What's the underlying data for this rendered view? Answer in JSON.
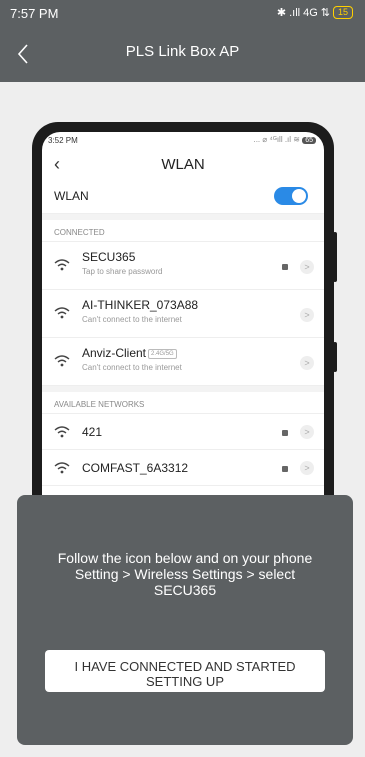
{
  "status_bar": {
    "time": "7:57 PM",
    "bluetooth": "✱",
    "signal": ".ıll",
    "network": "4G",
    "arrows": "⇅",
    "battery": "15"
  },
  "header": {
    "title": "PLS Link Box AP"
  },
  "illustration": {
    "status_time": "3:52 PM",
    "status_right": "... ⌀ ⁴ᴳıll .ıl ≋",
    "battery": "65",
    "screen_title": "WLAN",
    "back_glyph": "‹",
    "wlan_label": "WLAN",
    "wlan_toggle_on": true,
    "connected_label": "CONNECTED",
    "connected": [
      {
        "name": "SECU365",
        "sub": "Tap to share password",
        "locked": true
      },
      {
        "name": "AI-THINKER_073A88",
        "sub": "Can't connect to the internet",
        "locked": false
      },
      {
        "name": "Anviz-Client",
        "tag": "2.4G/5G",
        "sub": "Can't connect to the internet",
        "locked": false
      }
    ],
    "available_label": "AVAILABLE NETWORKS",
    "available": [
      {
        "name": "421",
        "locked": true
      },
      {
        "name": "COMFAST_6A3312",
        "locked": true
      }
    ],
    "arrow_glyph": ">"
  },
  "dialog": {
    "message": "Follow the icon below and on your phone Setting > Wireless Settings > select SECU365",
    "button_label": "I HAVE CONNECTED AND STARTED SETTING UP"
  },
  "colors": {
    "bar": "#5c6062",
    "background": "#eeeeee",
    "toggle": "#2a8ae6",
    "battery": "#ffd000"
  }
}
